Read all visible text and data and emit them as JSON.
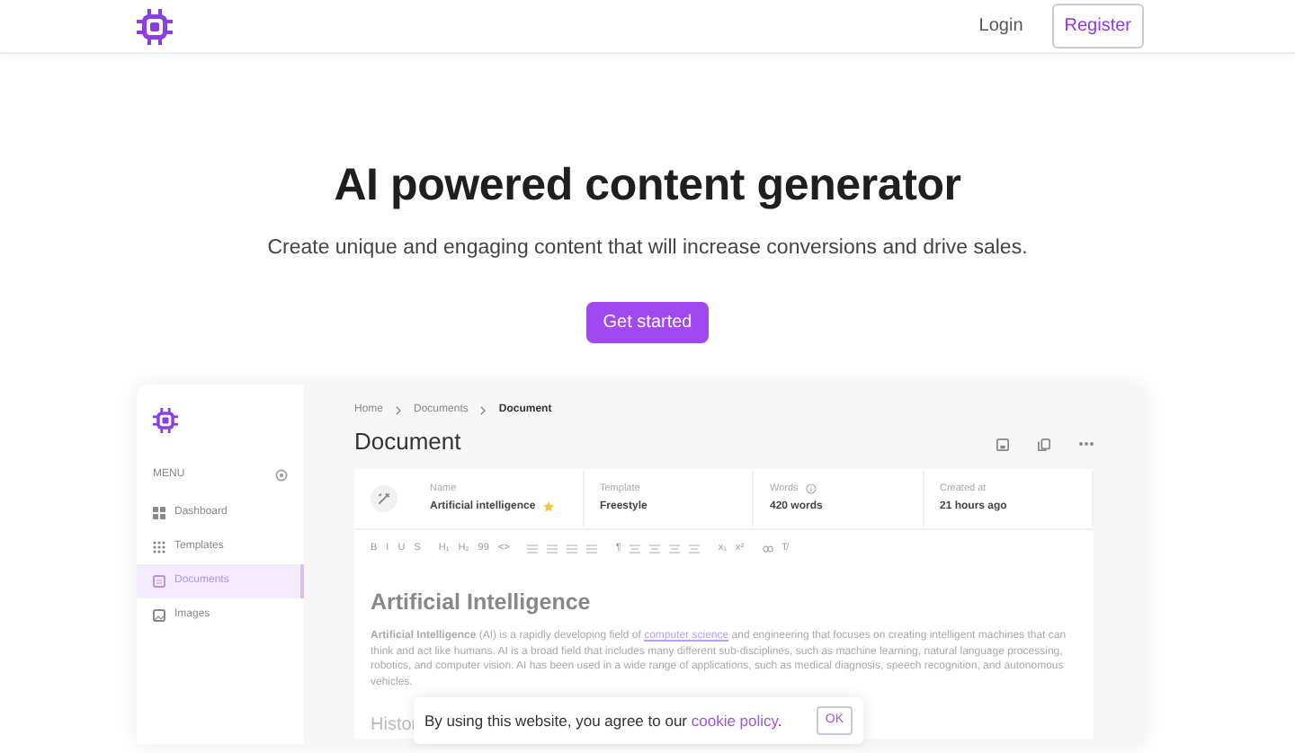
{
  "navbar": {
    "links": [
      {
        "label": "Login",
        "kind": "link"
      },
      {
        "label": "Register",
        "kind": "outline"
      }
    ]
  },
  "hero": {
    "title": "AI powered content generator",
    "subtitle": "Create unique and engaging content that will increase conversions and drive sales.",
    "button": "Get started"
  },
  "app": {
    "sidebar": {
      "menu_label": "MENU",
      "items": [
        {
          "label": "Dashboard",
          "selected": false
        },
        {
          "label": "Templates",
          "selected": false
        },
        {
          "label": "Documents",
          "selected": true
        },
        {
          "label": "Images",
          "selected": false
        }
      ]
    },
    "breadcrumb": [
      "Home",
      "Documents",
      "Document"
    ],
    "title": "Document",
    "info": [
      {
        "label": "Name",
        "value": "Artificial intelligence",
        "starred": true,
        "info": false
      },
      {
        "label": "Template",
        "value": "Freestyle",
        "starred": false,
        "info": false
      },
      {
        "label": "Words",
        "value": "420 words",
        "starred": false,
        "info": true
      },
      {
        "label": "Created at",
        "value": "21 hours ago",
        "starred": false,
        "info": false
      }
    ],
    "toolbar": [
      [
        {
          "kind": "text",
          "label": "B"
        },
        {
          "kind": "text",
          "label": "I"
        },
        {
          "kind": "text",
          "label": "U"
        },
        {
          "kind": "text",
          "label": "S"
        }
      ],
      [
        {
          "kind": "text",
          "label": "H₁"
        },
        {
          "kind": "text",
          "label": "H₂"
        },
        {
          "kind": "text",
          "label": "99"
        },
        {
          "kind": "text",
          "label": "<>"
        }
      ],
      [
        {
          "kind": "list"
        },
        {
          "kind": "list"
        },
        {
          "kind": "list"
        },
        {
          "kind": "list"
        }
      ],
      [
        {
          "kind": "text",
          "label": "¶"
        },
        {
          "kind": "align"
        },
        {
          "kind": "align"
        },
        {
          "kind": "align"
        },
        {
          "kind": "align"
        }
      ],
      [
        {
          "kind": "text",
          "label": "x₁"
        },
        {
          "kind": "text",
          "label": "x²"
        }
      ],
      [
        {
          "kind": "link"
        },
        {
          "kind": "text",
          "label": "T̸"
        }
      ]
    ],
    "heading": "Artificial Intelligence",
    "paragraph": {
      "before": "**Artificial Intelligence** (AI) is a rapidly developing field of ",
      "link": "computer science",
      "after": " and engineering that focuses on creating intelligent machines that can think and act like humans. AI is a broad field that includes many different sub-disciplines, such as machine learning, natural language processing, robotics, and computer vision. AI has been used in a wide range of applications, such as medical diagnosis, speech recognition, and autonomous vehicles."
    },
    "subheading": "Histor"
  },
  "cookie": {
    "before": "By using this website, you agree to our ",
    "link": "cookie policy",
    "after": ".",
    "button": "OK"
  }
}
